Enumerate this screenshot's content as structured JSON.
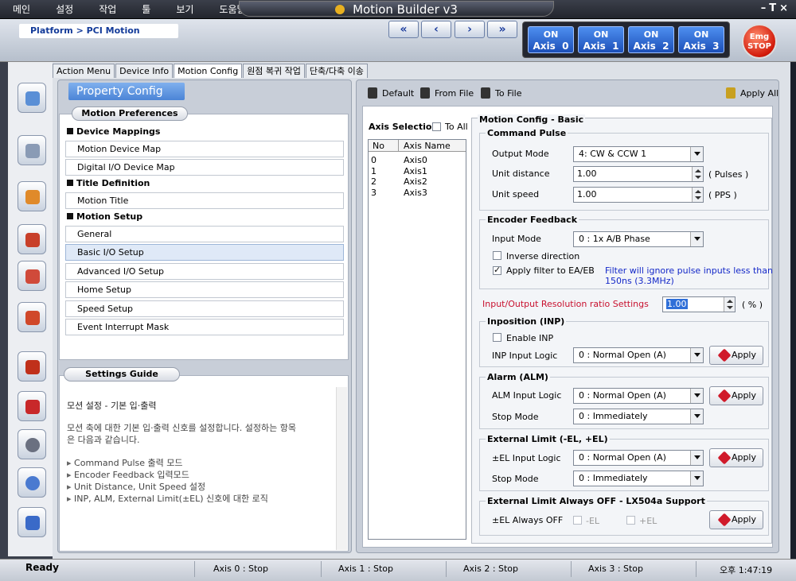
{
  "menu": [
    "메인",
    "설정",
    "작업",
    "툴",
    "보기",
    "도움말"
  ],
  "window": {
    "title": "Motion Builder v3",
    "controls": "–T×"
  },
  "header": {
    "breadcrumb": "Platform > PCI Motion",
    "nav": [
      "«",
      "‹",
      "›",
      "»"
    ],
    "axes": [
      {
        "state": "ON",
        "label": "Axis",
        "num": "0"
      },
      {
        "state": "ON",
        "label": "Axis",
        "num": "1"
      },
      {
        "state": "ON",
        "label": "Axis",
        "num": "2"
      },
      {
        "state": "ON",
        "label": "Axis",
        "num": "3"
      }
    ],
    "emg_top": "Emg",
    "emg_bottom": "STOP"
  },
  "rail_icons": [
    "motion-icon",
    "tools-icon",
    "home-icon",
    "io-icon",
    "edit-icon",
    "speed-icon",
    "pulse-icon",
    "signal-icon",
    "gear-icon",
    "user-icon",
    "sync-icon"
  ],
  "tabs": [
    "Action Menu",
    "Device Info",
    "Motion Config",
    "원점 복귀 작업",
    "단축/다축 이송"
  ],
  "left": {
    "panel_title": "Property Config",
    "pref_title": "Motion Preferences",
    "sections": [
      {
        "title": "Device Mappings",
        "items": [
          "Motion Device Map",
          "Digital I/O Device Map"
        ]
      },
      {
        "title": "Title Definition",
        "items": [
          "Motion Title"
        ]
      },
      {
        "title": "Motion Setup",
        "items": [
          "General",
          "Basic I/O Setup",
          "Advanced I/O Setup",
          "Home Setup",
          "Speed Setup",
          "Event Interrupt Mask"
        ]
      }
    ],
    "guide_title": "Settings Guide",
    "guide_heading": "모션 설정 - 기본 입·출력",
    "guide_desc1": "모션 축에 대한 기본 입·출력 신호를 설정합니다. 설정하는 항목",
    "guide_desc2": "은 다음과 같습니다.",
    "guide_bullets": [
      "Command Pulse 출력 모드",
      "Encoder Feedback 입력모드",
      "Unit Distance, Unit Speed 설정",
      "INP, ALM, External Limit(±EL) 신호에 대한 로직"
    ]
  },
  "toolbar": {
    "default": "Default",
    "from_file": "From File",
    "to_file": "To File",
    "apply_all": "Apply All"
  },
  "axis_sel": {
    "title": "Axis Selection",
    "to_all": "To All",
    "col_no": "No",
    "col_name": "Axis Name",
    "rows": [
      {
        "no": "0",
        "name": "Axis0"
      },
      {
        "no": "1",
        "name": "Axis1"
      },
      {
        "no": "2",
        "name": "Axis2"
      },
      {
        "no": "3",
        "name": "Axis3"
      }
    ]
  },
  "config": {
    "title": "Motion Config - Basic",
    "command_pulse": {
      "title": "Command Pulse",
      "output_mode_label": "Output Mode",
      "output_mode": "4: CW & CCW 1",
      "unit_distance_label": "Unit distance",
      "unit_distance": "1.00",
      "unit_distance_unit": "( Pulses )",
      "unit_speed_label": "Unit speed",
      "unit_speed": "1.00",
      "unit_speed_unit": "( PPS )"
    },
    "encoder": {
      "title": "Encoder Feedback",
      "input_mode_label": "Input Mode",
      "input_mode": "0 : 1x A/B Phase",
      "inverse": "Inverse direction",
      "apply_filter": "Apply filter to EA/EB",
      "filter_note1": "Filter will ignore pulse inputs less than",
      "filter_note2": "150ns (3.3MHz)"
    },
    "ratio": {
      "label": "Input/Output Resolution ratio Settings",
      "value": "1.00",
      "unit": "( % )"
    },
    "inp": {
      "title": "Inposition (INP)",
      "enable": "Enable INP",
      "logic_label": "INP Input Logic",
      "logic": "0 : Normal Open (A)",
      "apply": "Apply"
    },
    "alm": {
      "title": "Alarm (ALM)",
      "logic_label": "ALM Input Logic",
      "logic": "0 : Normal Open (A)",
      "stop_label": "Stop Mode",
      "stop": "0 : Immediately",
      "apply": "Apply"
    },
    "el": {
      "title": "External Limit (-EL, +EL)",
      "logic_label": "±EL Input Logic",
      "logic": "0 : Normal Open (A)",
      "stop_label": "Stop Mode",
      "stop": "0 : Immediately",
      "apply": "Apply"
    },
    "el_off": {
      "title": "External Limit Always OFF - LX504a Support",
      "label": "±EL Always OFF",
      "minus": "-EL",
      "plus": "+EL",
      "apply": "Apply"
    }
  },
  "status": {
    "ready": "Ready",
    "axis0": "Axis 0 :   Stop",
    "axis1": "Axis 1 :   Stop",
    "axis2": "Axis 2 :   Stop",
    "axis3": "Axis 3 :   Stop",
    "time": "오후 1:47:19"
  },
  "colors": {
    "accent": "#1a3b9c",
    "axis_on": "#2f6fd8",
    "emg": "#d21a0a",
    "ratio_label": "#c8102e",
    "filter_note": "#1428c8"
  }
}
